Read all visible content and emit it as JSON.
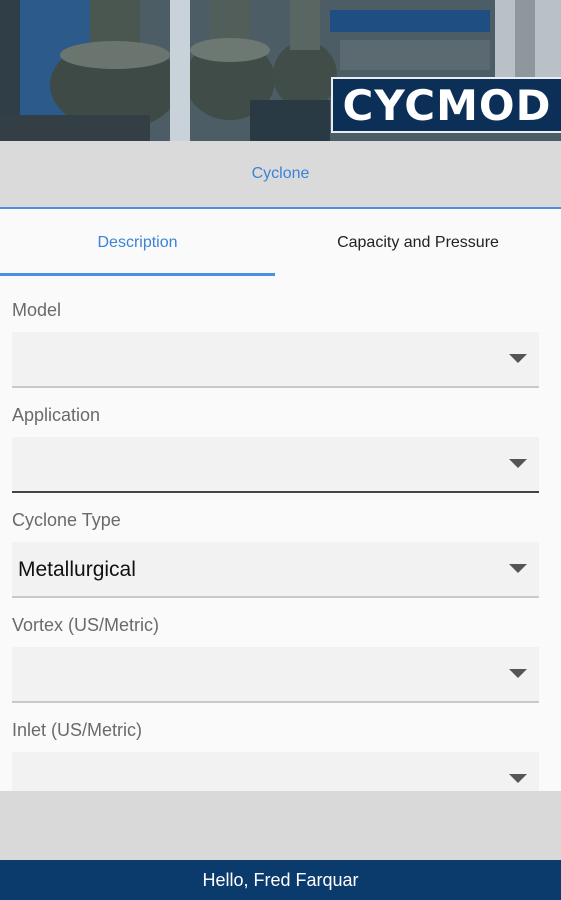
{
  "header": {
    "logo_text": "CYCMOD",
    "title": "Cyclone"
  },
  "tabs": [
    {
      "label": "Description",
      "active": true
    },
    {
      "label": "Capacity and Pressure",
      "active": false
    }
  ],
  "form": {
    "fields": [
      {
        "label": "Model",
        "value": ""
      },
      {
        "label": "Application",
        "value": ""
      },
      {
        "label": "Cyclone Type",
        "value": "Metallurgical"
      },
      {
        "label": "Vortex (US/Metric)",
        "value": ""
      },
      {
        "label": "Inlet (US/Metric)",
        "value": ""
      }
    ]
  },
  "footer": {
    "greeting": "Hello, Fred Farquar"
  },
  "colors": {
    "accent": "#4a90e2",
    "brand": "#0b3a6d"
  },
  "icons": {
    "dropdown": "caret-down-icon"
  }
}
